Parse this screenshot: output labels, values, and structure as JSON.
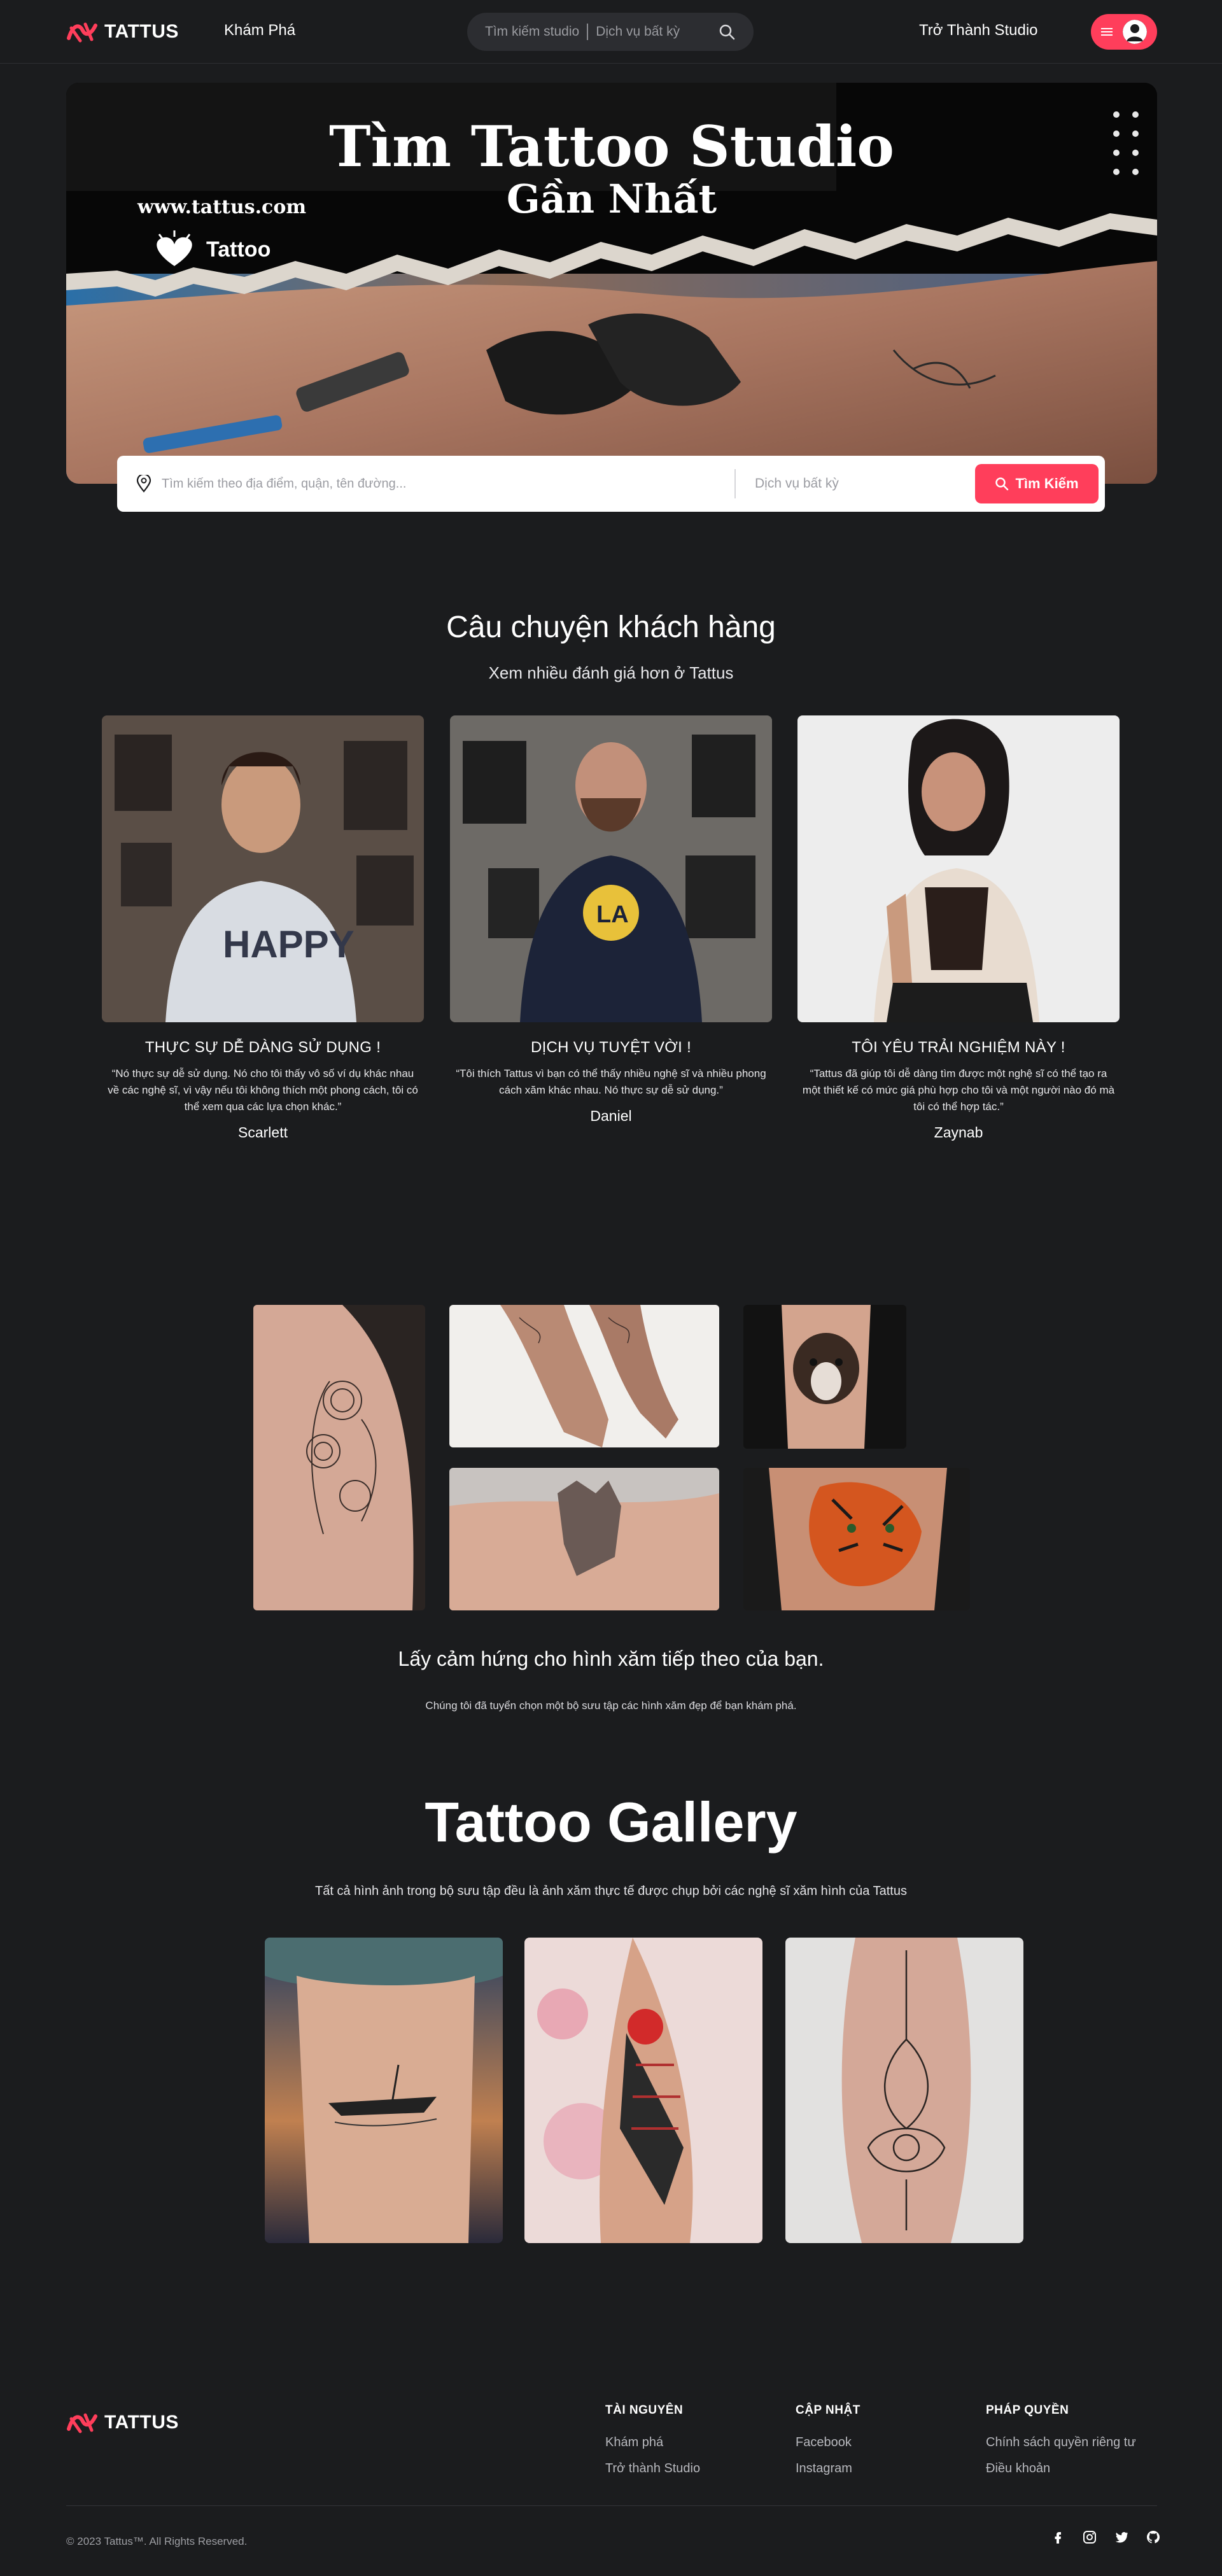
{
  "brand": {
    "name": "TATTUS",
    "accent": "#ff3e5b",
    "background": "#1b1c1e"
  },
  "nav": {
    "explore": "Khám Phá",
    "search_location": "Tìm kiếm studio",
    "search_service": "Dịch vụ bất kỳ",
    "become_studio": "Trở Thành Studio"
  },
  "hero": {
    "title_line1": "Tìm Tattoo Studio",
    "title_line2": "Gần Nhất",
    "url": "www.tattus.com",
    "brand_word": "Tattoo",
    "search_placeholder": "Tìm kiếm theo địa điểm, quận, tên đường...",
    "service_placeholder": "Dịch vụ bất kỳ",
    "search_button": "Tìm Kiếm"
  },
  "stories": {
    "title": "Câu chuyện khách hàng",
    "subtitle": "Xem nhiều đánh giá hơn ở Tattus",
    "items": [
      {
        "heading": "THỰC SỰ DỄ DÀNG SỬ DỤNG !",
        "quote": "“Nó thực sự dễ sử dụng. Nó cho tôi thấy vô số ví dụ khác nhau về các nghệ sĩ, vì vậy nếu tôi không thích một phong cách, tôi có thể xem qua các lựa chọn khác.”",
        "author": "Scarlett"
      },
      {
        "heading": "DỊCH VỤ TUYỆT VỜI !",
        "quote": "“Tôi thích Tattus vì bạn có thể thấy nhiều nghệ sĩ và nhiều phong cách xăm khác nhau. Nó thực sự dễ sử dụng.”",
        "author": "Daniel"
      },
      {
        "heading": "TÔI YÊU TRẢI NGHIỆM NÀY !",
        "quote": "“Tattus đã giúp tôi dễ dàng tìm được một nghệ sĩ có thể tạo ra một thiết kế có mức giá phù hợp cho tôi và một người nào đó mà tôi có thể hợp tác.”",
        "author": "Zaynab"
      }
    ]
  },
  "inspiration": {
    "title": "Lấy cảm hứng cho hình xăm tiếp theo của bạn.",
    "subtitle": "Chúng tôi đã tuyển chọn một bộ sưu tập các hình xăm đẹp để bạn khám phá."
  },
  "gallery": {
    "title": "Tattoo Gallery",
    "subtitle": "Tất cả hình ảnh trong bộ sưu tập đều là ảnh xăm thực tế được chụp bởi các nghệ sĩ xăm hình của Tattus"
  },
  "footer": {
    "columns": [
      {
        "title": "TÀI NGUYÊN",
        "links": [
          "Khám phá",
          "Trở thành Studio"
        ]
      },
      {
        "title": "CẬP NHẬT",
        "links": [
          "Facebook",
          "Instagram"
        ]
      },
      {
        "title": "PHÁP QUYỀN",
        "links": [
          "Chính sách quyền riêng tư",
          "Điều khoản"
        ]
      }
    ],
    "copyright": "© 2023 Tattus™. All Rights Reserved.",
    "social_icons": [
      "facebook-icon",
      "instagram-icon",
      "twitter-icon",
      "github-icon"
    ]
  }
}
